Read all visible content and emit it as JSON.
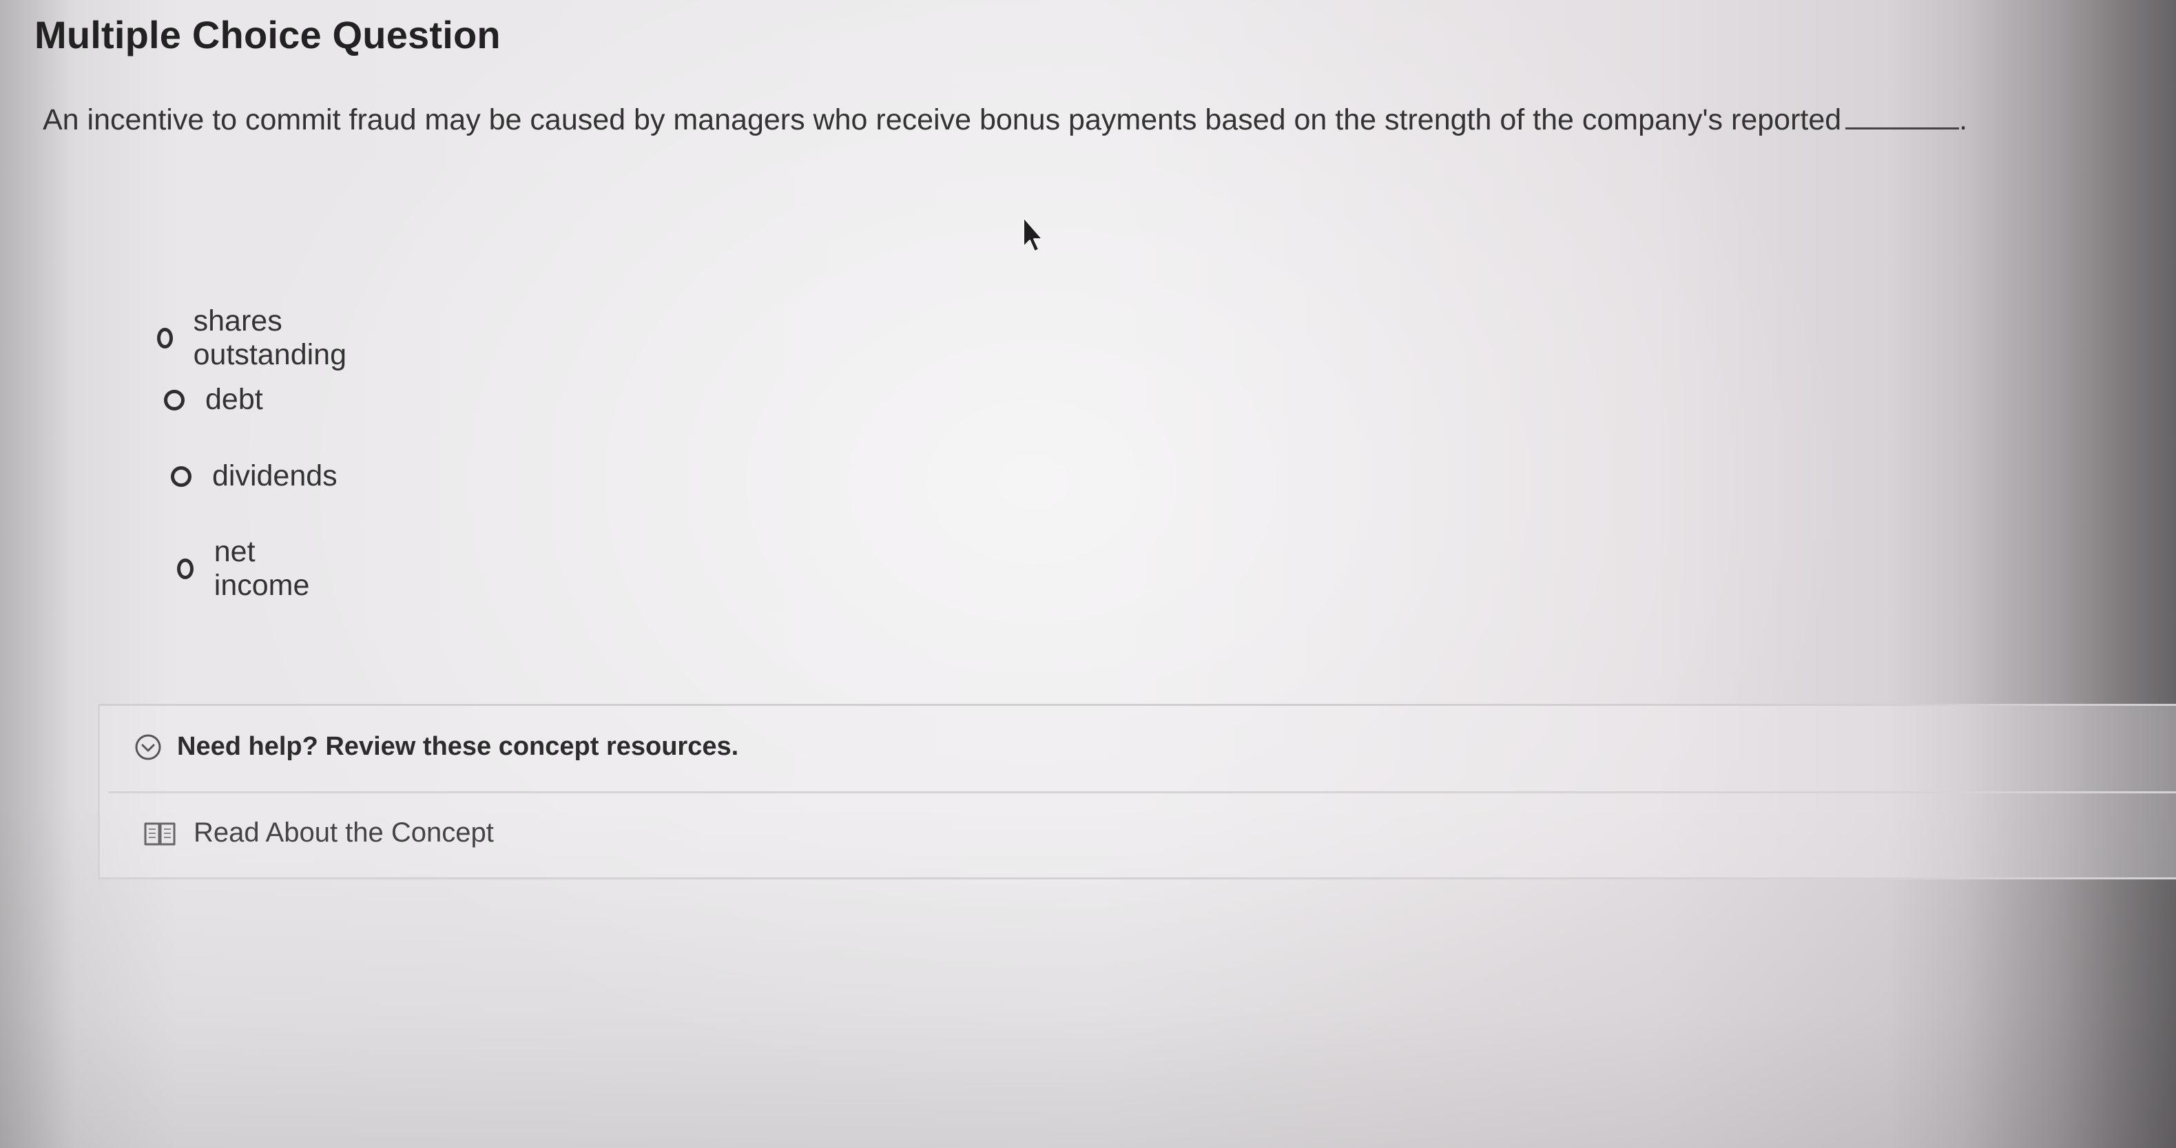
{
  "question": {
    "title": "Multiple Choice Question",
    "stem": "An incentive to commit fraud may be caused by managers who receive bonus payments based on the strength of the company's reported",
    "stem_end": "."
  },
  "choices": [
    {
      "label": "shares outstanding",
      "selected": false
    },
    {
      "label": "debt",
      "selected": false
    },
    {
      "label": "dividends",
      "selected": false
    },
    {
      "label": "net income",
      "selected": false
    }
  ],
  "help": {
    "toggle_label": "Need help? Review these concept resources.",
    "toggle_icon": "chevron-circle-down-icon",
    "link_label": "Read About the Concept",
    "link_icon": "book-icon"
  },
  "colors": {
    "text": "#333333",
    "title": "#222222"
  }
}
